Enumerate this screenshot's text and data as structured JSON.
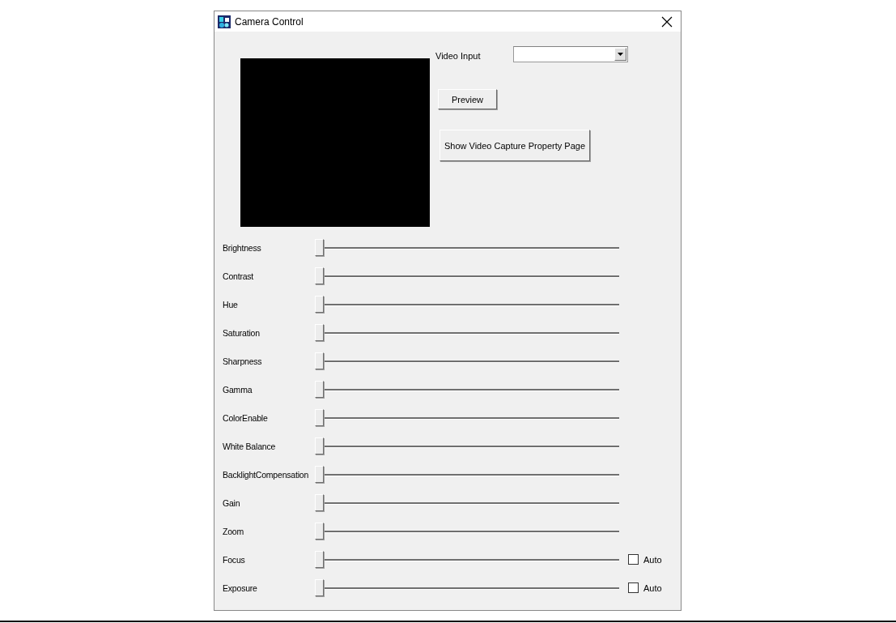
{
  "window": {
    "title": "Camera Control"
  },
  "video_input": {
    "label": "Video Input"
  },
  "buttons": [
    {
      "label": "Preview",
      "kind": "small"
    },
    {
      "label": "Show Video Capture Property Page",
      "kind": "large"
    }
  ],
  "sliders": [
    {
      "label": "Brightness",
      "level": 0
    },
    {
      "label": "Contrast",
      "level": 0
    },
    {
      "label": "Hue",
      "level": 0
    },
    {
      "label": "Saturation",
      "level": 0
    },
    {
      "label": "Sharpness",
      "level": 0
    },
    {
      "label": "Gamma",
      "level": 0
    },
    {
      "label": "ColorEnable",
      "level": 0
    },
    {
      "label": "White Balance",
      "level": 0
    },
    {
      "label": "BacklightCompensation",
      "level": 0
    },
    {
      "label": "Gain",
      "level": 0
    },
    {
      "label": "Zoom",
      "level": 0
    },
    {
      "label": "Focus",
      "level": 0,
      "auto": {
        "label": "Auto",
        "checked": false
      }
    },
    {
      "label": "Exposure",
      "level": 0,
      "auto": {
        "label": "Auto",
        "checked": false
      }
    }
  ]
}
